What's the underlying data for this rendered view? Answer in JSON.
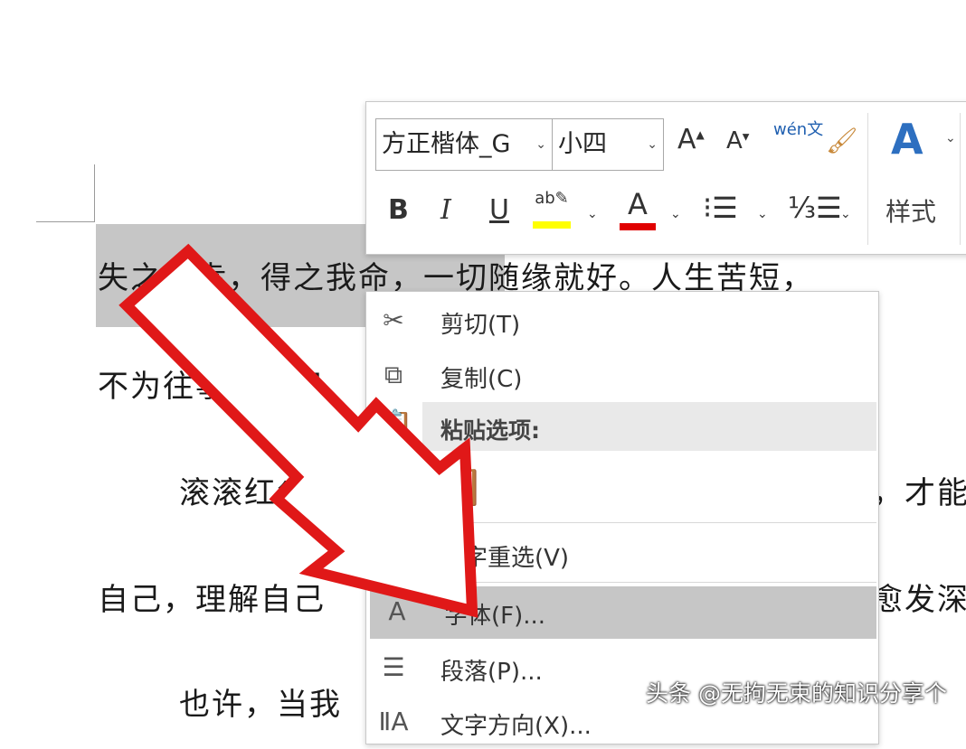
{
  "document": {
    "line1": "失之我幸，得之我命，一切随缘就好。人生苦短，",
    "line2": "不为往事忧，只",
    "line3": "滚滚红尘，",
    "line3_right": "，才能",
    "line4": "自己，理解自己",
    "line4_right": "愈发深",
    "line5": "也许，当我"
  },
  "toolbar": {
    "font_name": "方正楷体_G",
    "font_size": "小四",
    "styles_label": "样式",
    "wen_label": "wén文",
    "colors": {
      "highlight": "#ffff00",
      "font_color": "#e00000"
    }
  },
  "context_menu": {
    "cut": "剪切(T)",
    "copy": "复制(C)",
    "paste_options": "粘贴选项:",
    "reconvert": "汉字重选(V)",
    "font": "字体(F)...",
    "paragraph": "段落(P)...",
    "text_direction": "文字方向(X)..."
  },
  "watermark": "头条 @无拘无束的知识分享个"
}
